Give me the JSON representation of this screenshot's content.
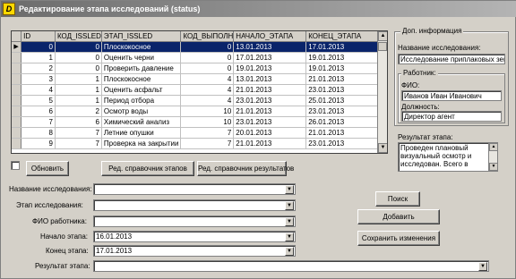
{
  "window": {
    "title": "Редактирование этапа исследований (status)",
    "icon_letter": "D"
  },
  "grid": {
    "columns": [
      "ID",
      "КОД_ISSLED",
      "ЭТАП_ISSLED",
      "КОД_ВЫПОЛН",
      "НАЧАЛО_ЭТАПА",
      "КОНЕЦ_ЭТАПА"
    ],
    "rows": [
      [
        "0",
        "0",
        "Плоскокосное",
        "0",
        "13.01.2013",
        "17.01.2013"
      ],
      [
        "1",
        "0",
        "Оценить черни",
        "0",
        "17.01.2013",
        "19.01.2013"
      ],
      [
        "2",
        "0",
        "Проверить давление",
        "0",
        "19.01.2013",
        "19.01.2013"
      ],
      [
        "3",
        "1",
        "Плоскокосное",
        "4",
        "13.01.2013",
        "21.01.2013"
      ],
      [
        "4",
        "1",
        "Оценить асфальт",
        "4",
        "21.01.2013",
        "23.01.2013"
      ],
      [
        "5",
        "1",
        "Период отбора",
        "4",
        "23.01.2013",
        "25.01.2013"
      ],
      [
        "6",
        "2",
        "Осмотр воды",
        "10",
        "21.01.2013",
        "23.01.2013"
      ],
      [
        "7",
        "6",
        "Химический анализ",
        "10",
        "23.01.2013",
        "26.01.2013"
      ],
      [
        "8",
        "7",
        "Летние опушки",
        "7",
        "20.01.2013",
        "21.01.2013"
      ],
      [
        "9",
        "7",
        "Проверка на закрытии",
        "7",
        "21.01.2013",
        "23.01.2013"
      ]
    ],
    "selected_row": 0
  },
  "formation_group": {
    "legend": "Доп. информация",
    "research_label": "Название исследования:",
    "research_value": "Исследование приплаковых зем.",
    "executor_legend": "Работник:",
    "fio_label": "ФИО:",
    "fio_value": "Иванов Иван Иванович",
    "position_label": "Должность:",
    "position_value": "Директор агент"
  },
  "result_memo": {
    "label": "Результат этапа:",
    "text": "Проведен плановый визуальный осмотр и исследован. Всего в"
  },
  "buttons": {
    "refresh": "Обновить",
    "edit_stages": "Ред. справочник этапов",
    "edit_results": "Ред. справочник результатов",
    "find": "Поиск",
    "add": "Добавить",
    "save": "Сохранить изменения"
  },
  "form": {
    "research_label": "Название исследования:",
    "stage_label": "Этап исследования:",
    "fio_label": "ФИО работника:",
    "start_label": "Начало этапа:",
    "end_label": "Конец этапа:",
    "result_label": "Результат этапа:",
    "start_value": "16.01.2013",
    "end_value": "17.01.2013"
  }
}
